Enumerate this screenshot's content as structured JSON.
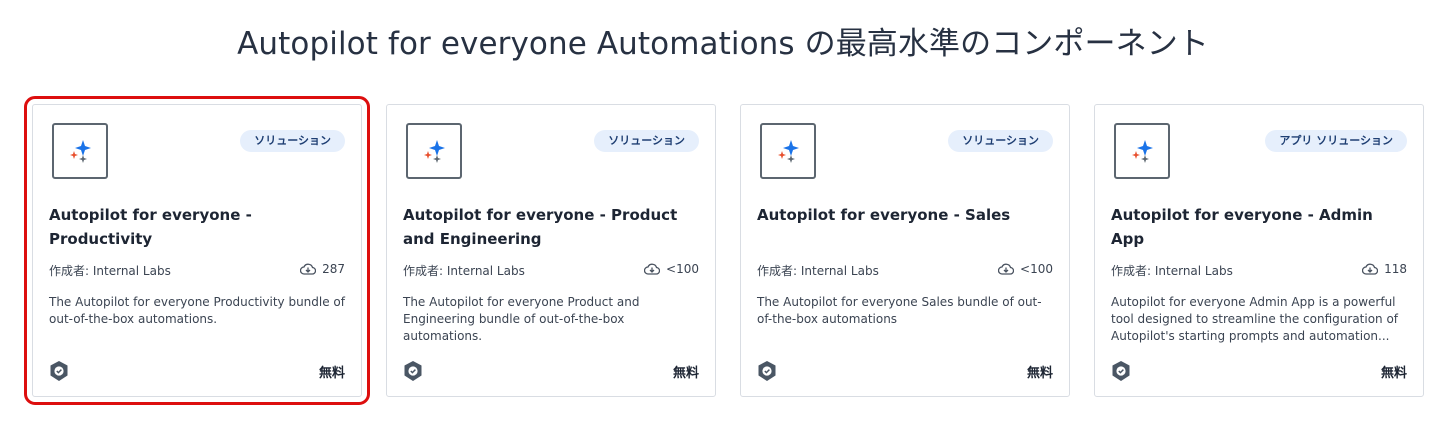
{
  "section_title": "Autopilot for everyone Automations の最高水準のコンポーネント",
  "cards": [
    {
      "badge": "ソリューション",
      "title": "Autopilot for everyone - Productivity",
      "author": "作成者: Internal Labs",
      "downloads": "287",
      "description": "The Autopilot for everyone Productivity bundle of out-of-the-box automations.",
      "price": "無料"
    },
    {
      "badge": "ソリューション",
      "title": "Autopilot for everyone - Product and Engineering",
      "author": "作成者: Internal Labs",
      "downloads": "<100",
      "description": "The Autopilot for everyone Product and Engineering bundle of out-of-the-box automations.",
      "price": "無料"
    },
    {
      "badge": "ソリューション",
      "title": "Autopilot for everyone - Sales",
      "author": "作成者: Internal Labs",
      "downloads": "<100",
      "description": "The Autopilot for everyone Sales bundle of out-of-the-box automations",
      "price": "無料"
    },
    {
      "badge": "アプリ ソリューション",
      "title": "Autopilot for everyone - Admin App",
      "author": "作成者: Internal Labs",
      "downloads": "118",
      "description": "Autopilot for everyone Admin App is a powerful tool designed to streamline the configuration of Autopilot's starting prompts and automation...",
      "price": "無料"
    }
  ],
  "icons": {
    "logo": "sparkle-icon",
    "downloads": "cloud-download-icon",
    "verified": "shield-check-icon"
  },
  "colors": {
    "selection_outline": "#dd0e0e",
    "badge_bg": "#e6effc",
    "sparkle_blue": "#1a73e8",
    "sparkle_red": "#e8502e"
  }
}
